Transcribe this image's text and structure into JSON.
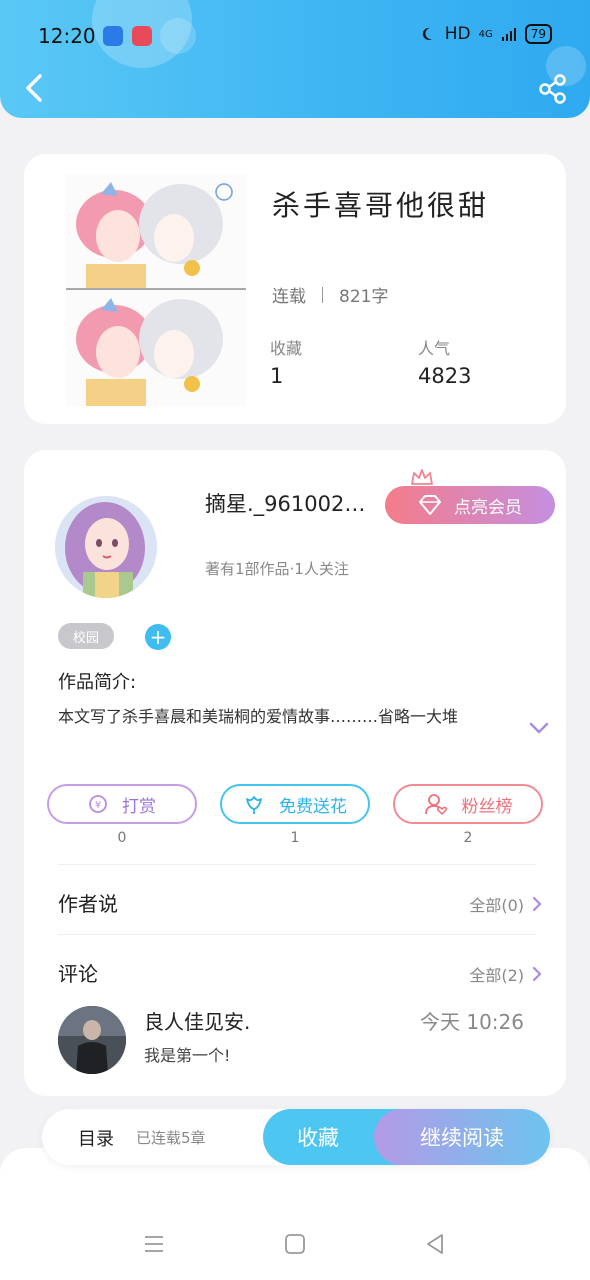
{
  "status_bar": {
    "time": "12:20",
    "network": "HD",
    "signal": "4G",
    "battery": "79"
  },
  "book": {
    "title": "杀手喜哥他很甜",
    "status": "连载",
    "word_count": "821字",
    "favorites_label": "收藏",
    "favorites_value": "1",
    "popularity_label": "人气",
    "popularity_value": "4823"
  },
  "author": {
    "name": "摘星._961002…",
    "vip_label": "点亮会员",
    "subtitle": "著有1部作品·1人关注",
    "tag": "校园",
    "tag_add": "+",
    "intro_label": "作品简介:",
    "intro_text": "本文写了杀手喜晨和美瑞桐的爱情故事………省略一大堆"
  },
  "actions": [
    {
      "label": "打赏",
      "count": "0",
      "icon": "coin-icon"
    },
    {
      "label": "免费送花",
      "count": "1",
      "icon": "flower-icon"
    },
    {
      "label": "粉丝榜",
      "count": "2",
      "icon": "fans-icon"
    }
  ],
  "author_says": {
    "title": "作者说",
    "link": "全部(0)"
  },
  "comments": {
    "title": "评论",
    "link": "全部(2)",
    "items": [
      {
        "user": "良人佳见安.",
        "time": "今天 10:26",
        "text": "我是第一个!"
      }
    ]
  },
  "bottom_bar": {
    "toc": "目录",
    "chapters": "已连载5章",
    "collect": "收藏",
    "continue": "继续阅读"
  },
  "colors": {
    "header": "#3fb6f3",
    "accent_blue": "#4dc6f1",
    "accent_pink": "#f57c8a",
    "accent_purple": "#c48fe0"
  }
}
